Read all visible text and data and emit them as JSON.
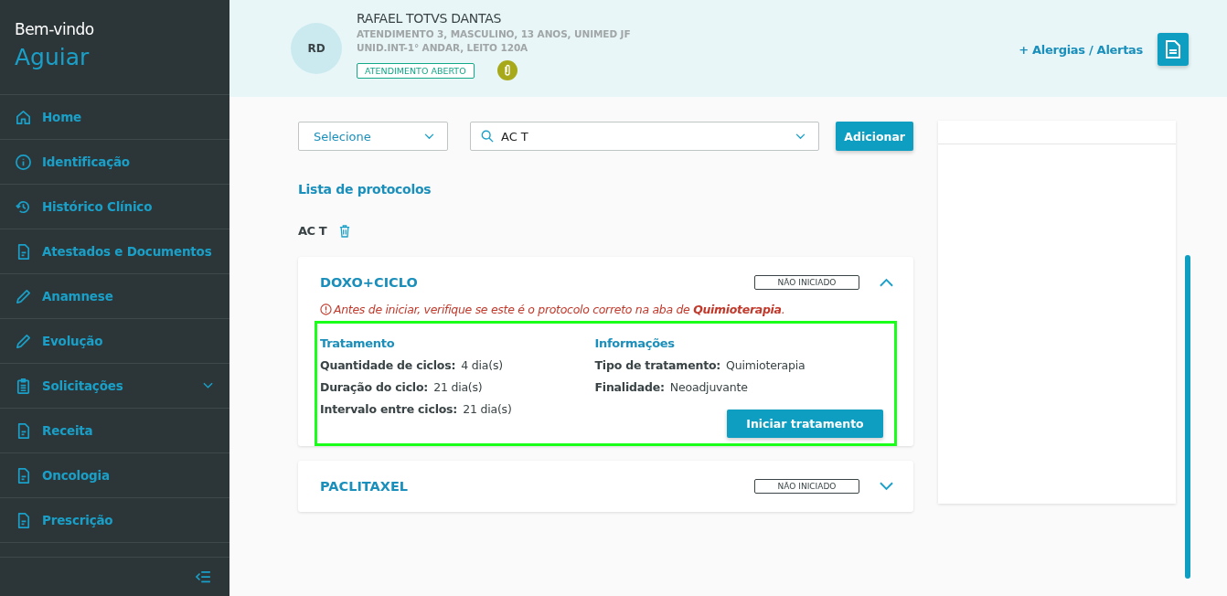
{
  "sidebar": {
    "greeting": "Bem-vindo",
    "user": "Aguiar",
    "items": [
      {
        "label": "Home",
        "kind": "home",
        "expandable": false
      },
      {
        "label": "Identificação",
        "kind": "info",
        "expandable": false
      },
      {
        "label": "Histórico Clínico",
        "kind": "history",
        "expandable": false
      },
      {
        "label": "Atestados e Documentos",
        "kind": "doc",
        "expandable": false
      },
      {
        "label": "Anamnese",
        "kind": "pencil",
        "expandable": false
      },
      {
        "label": "Evolução",
        "kind": "pencil",
        "expandable": false
      },
      {
        "label": "Solicitações",
        "kind": "clipboard",
        "expandable": true
      },
      {
        "label": "Receita",
        "kind": "doc",
        "expandable": false
      },
      {
        "label": "Oncologia",
        "kind": "doc",
        "expandable": false
      },
      {
        "label": "Prescrição",
        "kind": "doc",
        "expandable": false
      }
    ]
  },
  "patient": {
    "initials": "RD",
    "name": "RAFAEL TOTVS DANTAS",
    "details": [
      "ATENDIMENTO 3, MASCULINO, 13 ANOS, UNIMED JF",
      "UNID.INT-1° ANDAR, LEITO 120A"
    ],
    "status": "ATENDIMENTO ABERTO"
  },
  "header_actions": {
    "alerts_link": "+ Alergias / Alertas"
  },
  "toolbar": {
    "type_select": {
      "placeholder": "Selecione"
    },
    "search": {
      "value": "AC T"
    },
    "add_button": "Adicionar"
  },
  "list_title": "Lista de protocolos",
  "group": {
    "name": "AC T"
  },
  "protocols": [
    {
      "name": "DOXO+CICLO",
      "status": "NÃO INICIADO",
      "expanded": true,
      "warning": "Antes de iniciar, verifique se este é o protocolo correto na aba de **Quimioterapia**.",
      "treatment": {
        "title": "Tratamento",
        "rows": [
          {
            "label": "Quantidade de ciclos:",
            "value": "4 dia(s)"
          },
          {
            "label": "Duração do ciclo:",
            "value": "21 dia(s)"
          },
          {
            "label": "Intervalo entre ciclos:",
            "value": "21 dia(s)"
          }
        ]
      },
      "info": {
        "title": "Informações",
        "rows": [
          {
            "label": "Tipo de tratamento:",
            "value": "Quimioterapia"
          },
          {
            "label": "Finalidade:",
            "value": "Neoadjuvante"
          }
        ]
      },
      "start_button": "Iniciar tratamento"
    },
    {
      "name": "PACLITAXEL",
      "status": "NÃO INICIADO",
      "expanded": false
    }
  ]
}
